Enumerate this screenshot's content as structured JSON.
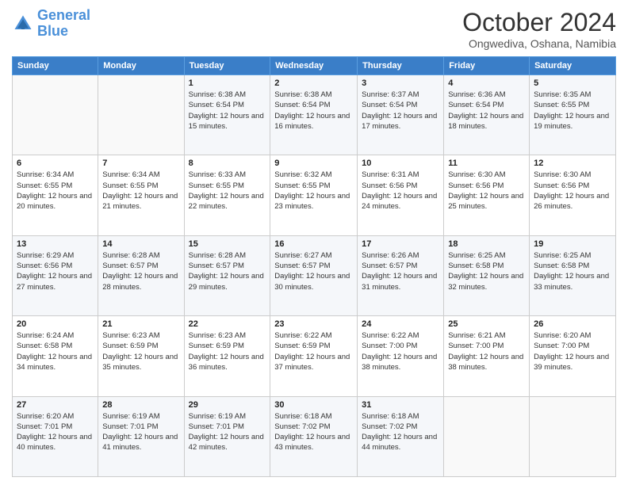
{
  "logo": {
    "line1": "General",
    "line2": "Blue"
  },
  "title": "October 2024",
  "subtitle": "Ongwediva, Oshana, Namibia",
  "days_of_week": [
    "Sunday",
    "Monday",
    "Tuesday",
    "Wednesday",
    "Thursday",
    "Friday",
    "Saturday"
  ],
  "weeks": [
    [
      {
        "day": "",
        "info": ""
      },
      {
        "day": "",
        "info": ""
      },
      {
        "day": "1",
        "info": "Sunrise: 6:38 AM\nSunset: 6:54 PM\nDaylight: 12 hours and 15 minutes."
      },
      {
        "day": "2",
        "info": "Sunrise: 6:38 AM\nSunset: 6:54 PM\nDaylight: 12 hours and 16 minutes."
      },
      {
        "day": "3",
        "info": "Sunrise: 6:37 AM\nSunset: 6:54 PM\nDaylight: 12 hours and 17 minutes."
      },
      {
        "day": "4",
        "info": "Sunrise: 6:36 AM\nSunset: 6:54 PM\nDaylight: 12 hours and 18 minutes."
      },
      {
        "day": "5",
        "info": "Sunrise: 6:35 AM\nSunset: 6:55 PM\nDaylight: 12 hours and 19 minutes."
      }
    ],
    [
      {
        "day": "6",
        "info": "Sunrise: 6:34 AM\nSunset: 6:55 PM\nDaylight: 12 hours and 20 minutes."
      },
      {
        "day": "7",
        "info": "Sunrise: 6:34 AM\nSunset: 6:55 PM\nDaylight: 12 hours and 21 minutes."
      },
      {
        "day": "8",
        "info": "Sunrise: 6:33 AM\nSunset: 6:55 PM\nDaylight: 12 hours and 22 minutes."
      },
      {
        "day": "9",
        "info": "Sunrise: 6:32 AM\nSunset: 6:55 PM\nDaylight: 12 hours and 23 minutes."
      },
      {
        "day": "10",
        "info": "Sunrise: 6:31 AM\nSunset: 6:56 PM\nDaylight: 12 hours and 24 minutes."
      },
      {
        "day": "11",
        "info": "Sunrise: 6:30 AM\nSunset: 6:56 PM\nDaylight: 12 hours and 25 minutes."
      },
      {
        "day": "12",
        "info": "Sunrise: 6:30 AM\nSunset: 6:56 PM\nDaylight: 12 hours and 26 minutes."
      }
    ],
    [
      {
        "day": "13",
        "info": "Sunrise: 6:29 AM\nSunset: 6:56 PM\nDaylight: 12 hours and 27 minutes."
      },
      {
        "day": "14",
        "info": "Sunrise: 6:28 AM\nSunset: 6:57 PM\nDaylight: 12 hours and 28 minutes."
      },
      {
        "day": "15",
        "info": "Sunrise: 6:28 AM\nSunset: 6:57 PM\nDaylight: 12 hours and 29 minutes."
      },
      {
        "day": "16",
        "info": "Sunrise: 6:27 AM\nSunset: 6:57 PM\nDaylight: 12 hours and 30 minutes."
      },
      {
        "day": "17",
        "info": "Sunrise: 6:26 AM\nSunset: 6:57 PM\nDaylight: 12 hours and 31 minutes."
      },
      {
        "day": "18",
        "info": "Sunrise: 6:25 AM\nSunset: 6:58 PM\nDaylight: 12 hours and 32 minutes."
      },
      {
        "day": "19",
        "info": "Sunrise: 6:25 AM\nSunset: 6:58 PM\nDaylight: 12 hours and 33 minutes."
      }
    ],
    [
      {
        "day": "20",
        "info": "Sunrise: 6:24 AM\nSunset: 6:58 PM\nDaylight: 12 hours and 34 minutes."
      },
      {
        "day": "21",
        "info": "Sunrise: 6:23 AM\nSunset: 6:59 PM\nDaylight: 12 hours and 35 minutes."
      },
      {
        "day": "22",
        "info": "Sunrise: 6:23 AM\nSunset: 6:59 PM\nDaylight: 12 hours and 36 minutes."
      },
      {
        "day": "23",
        "info": "Sunrise: 6:22 AM\nSunset: 6:59 PM\nDaylight: 12 hours and 37 minutes."
      },
      {
        "day": "24",
        "info": "Sunrise: 6:22 AM\nSunset: 7:00 PM\nDaylight: 12 hours and 38 minutes."
      },
      {
        "day": "25",
        "info": "Sunrise: 6:21 AM\nSunset: 7:00 PM\nDaylight: 12 hours and 38 minutes."
      },
      {
        "day": "26",
        "info": "Sunrise: 6:20 AM\nSunset: 7:00 PM\nDaylight: 12 hours and 39 minutes."
      }
    ],
    [
      {
        "day": "27",
        "info": "Sunrise: 6:20 AM\nSunset: 7:01 PM\nDaylight: 12 hours and 40 minutes."
      },
      {
        "day": "28",
        "info": "Sunrise: 6:19 AM\nSunset: 7:01 PM\nDaylight: 12 hours and 41 minutes."
      },
      {
        "day": "29",
        "info": "Sunrise: 6:19 AM\nSunset: 7:01 PM\nDaylight: 12 hours and 42 minutes."
      },
      {
        "day": "30",
        "info": "Sunrise: 6:18 AM\nSunset: 7:02 PM\nDaylight: 12 hours and 43 minutes."
      },
      {
        "day": "31",
        "info": "Sunrise: 6:18 AM\nSunset: 7:02 PM\nDaylight: 12 hours and 44 minutes."
      },
      {
        "day": "",
        "info": ""
      },
      {
        "day": "",
        "info": ""
      }
    ]
  ]
}
